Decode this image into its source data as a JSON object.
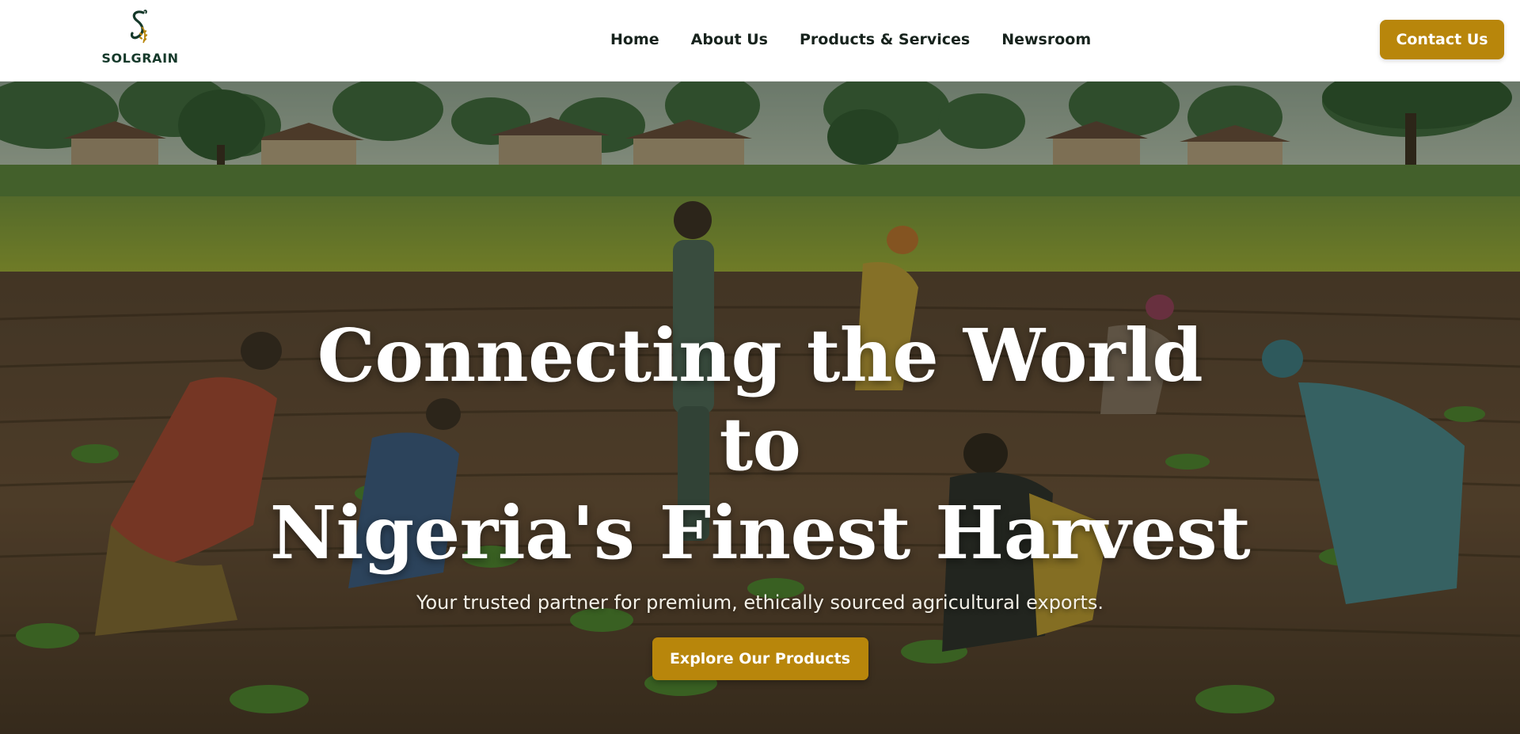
{
  "brand": {
    "name": "SOLGRAIN",
    "logo_icon": "solgrain-s-wheat-logo",
    "colors": {
      "primary": "#15392a",
      "accent": "#b8860b"
    }
  },
  "nav": {
    "items": [
      {
        "label": "Home"
      },
      {
        "label": "About Us"
      },
      {
        "label": "Products & Services"
      },
      {
        "label": "Newsroom"
      }
    ],
    "contact_label": "Contact Us"
  },
  "hero": {
    "title_line1": "Connecting the World to",
    "title_line2": "Nigeria's Finest Harvest",
    "subtitle": "Your trusted partner for premium, ethically sourced agricultural exports.",
    "cta_label": "Explore Our Products",
    "background": "farm-field-workers-photo"
  }
}
